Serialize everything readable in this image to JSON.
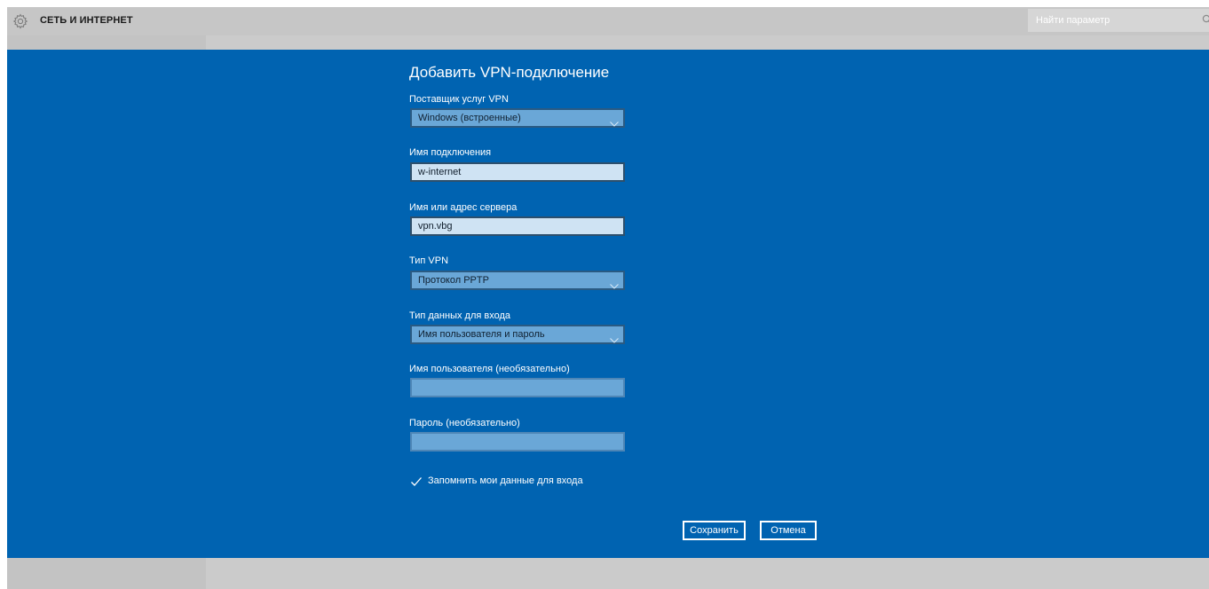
{
  "window": {
    "title": "СЕТЬ И ИНТЕРНЕТ",
    "icon": "gear-icon"
  },
  "search": {
    "placeholder": "Найти параметр",
    "icon": "search-icon"
  },
  "dialog": {
    "title": "Добавить VPN-подключение",
    "fields": {
      "provider": {
        "label": "Поставщик услуг VPN",
        "value": "Windows (встроенные)"
      },
      "connection_name": {
        "label": "Имя подключения",
        "value": "w-internet"
      },
      "server": {
        "label": "Имя или адрес сервера",
        "value": "vpn.vbg"
      },
      "vpn_type": {
        "label": "Тип VPN",
        "value": "Протокол PPTP"
      },
      "signin_type": {
        "label": "Тип данных для входа",
        "value": "Имя пользователя и пароль"
      },
      "username": {
        "label": "Имя пользователя (необязательно)",
        "value": ""
      },
      "password": {
        "label": "Пароль (необязательно)",
        "value": ""
      }
    },
    "remember": {
      "label": "Запомнить мои данные для входа",
      "checked": true
    },
    "buttons": {
      "save": "Сохранить",
      "cancel": "Отмена"
    }
  },
  "colors": {
    "overlay": "#0063b1",
    "titlebar": "#c6c6c6",
    "field_bg": "#6aa7d7",
    "field_filled_bg": "#cfe3f3"
  }
}
